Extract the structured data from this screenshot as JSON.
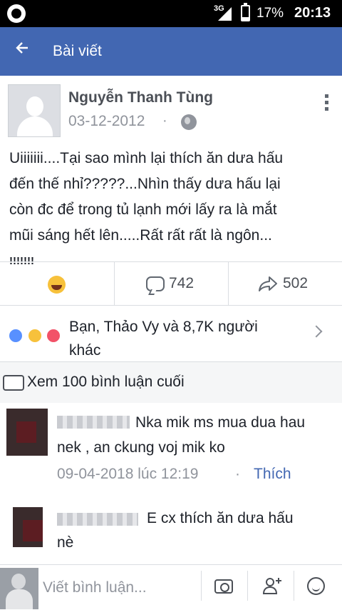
{
  "status_bar": {
    "network": "3G",
    "battery": "17%",
    "time": "20:13"
  },
  "header": {
    "title": "Bài viết"
  },
  "post": {
    "author": "Nguyễn Thanh Tùng",
    "date": "03-12-2012",
    "separator": "·",
    "lines": [
      "Uiiiiiii....Tại sao mình lại thích ăn dưa hấu",
      "đến thế nhỉ?????...Nhìn thấy dưa hấu lại",
      "còn đc để trong tủ lạnh mới lấy ra là mắt",
      "mũi sáng hết lên.....Rất rất rất là ngôn...",
      "!!!!!!!"
    ],
    "comment_count": "742",
    "share_count": "502",
    "reactions_text": "Bạn, Thảo Vy và 8,7K người",
    "reactions_text_line2": "khác"
  },
  "comments_section": {
    "previous_label": "Xem 100 bình luận cuối",
    "items": [
      {
        "text_line1": "Nka mik ms mua dua hau",
        "text_line2": "nek , an ckung voj mik ko",
        "time": "09-04-2018 lúc 12:19",
        "separator": "·",
        "like": "Thích"
      },
      {
        "text_line1": "E cx thích ăn dưa hấu",
        "text_line2": "nè"
      }
    ]
  },
  "composer": {
    "placeholder": "Viết bình luận..."
  },
  "colors": {
    "brand": "#4267b2",
    "secondary_text": "#90949c",
    "haha": "#f7c13b",
    "love": "#f25268",
    "like": "#5890ff"
  },
  "icons": [
    "aperture-icon",
    "signal-icon",
    "battery-icon",
    "back-arrow-icon",
    "globe-icon",
    "more-vertical-icon",
    "haha-reaction-icon",
    "comment-icon",
    "share-icon",
    "like-reaction-icon",
    "love-reaction-icon",
    "chevron-right-icon",
    "comment-bubble-icon",
    "camera-icon",
    "add-friend-icon",
    "emoji-icon"
  ]
}
